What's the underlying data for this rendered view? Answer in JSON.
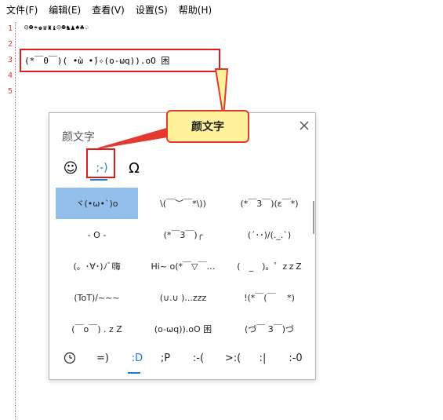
{
  "menubar": {
    "items": [
      "文件(F)",
      "编辑(E)",
      "查看(V)",
      "设置(S)",
      "帮助(H)"
    ]
  },
  "editor": {
    "line_numbers": [
      "1",
      "2",
      "3",
      "4",
      "5"
    ],
    "lines": [
      "☺☻☂♚♛♜♝☺☻♞♟♠♣♤",
      "",
      "(*￣0￣)( •̀ω •́)✧(o-ωq)).oO 困",
      "",
      ""
    ]
  },
  "callout": {
    "text": "颜文字"
  },
  "panel": {
    "title": "颜文字",
    "tabs": [
      {
        "icon": "smiley-icon",
        "label": "☺"
      },
      {
        "icon": "kaomoji-icon",
        "label": ";-)"
      },
      {
        "icon": "omega-icon",
        "label": "Ω"
      }
    ],
    "kaomoji": [
      "ヾ(•ω•`)o",
      "\\(￣︶￣*\\))",
      "(*￣3￣)(ε￣*)",
      "- O -",
      "(*￣3￣)╭",
      "(´･･)/(._.`)",
      "(。･∀･)ﾉﾞ嗨",
      "Hi~ o(*￣▽￣…",
      "(　_　)。゜zｚZ",
      "(ToT)/~~~",
      "(∪.∪ )...zzz",
      "!(*￣(￣ 　*)",
      "(￣o￣) . z Z",
      "(o-ωq)).oO 困",
      "(づ￣ 3￣)づ"
    ],
    "bottom_tabs": [
      {
        "icon": "clock-icon",
        "label": ""
      },
      {
        "label": "=)"
      },
      {
        "label": ":D"
      },
      {
        "label": ";P"
      },
      {
        "label": ":-("
      },
      {
        "label": ">:("
      },
      {
        "label": ":|"
      },
      {
        "label": ":-0"
      }
    ],
    "colors": {
      "accent": "#1e7ad6",
      "selected": "#92c0ea",
      "annotation": "#e11b1b",
      "callout_bg": "#fff29a"
    }
  }
}
